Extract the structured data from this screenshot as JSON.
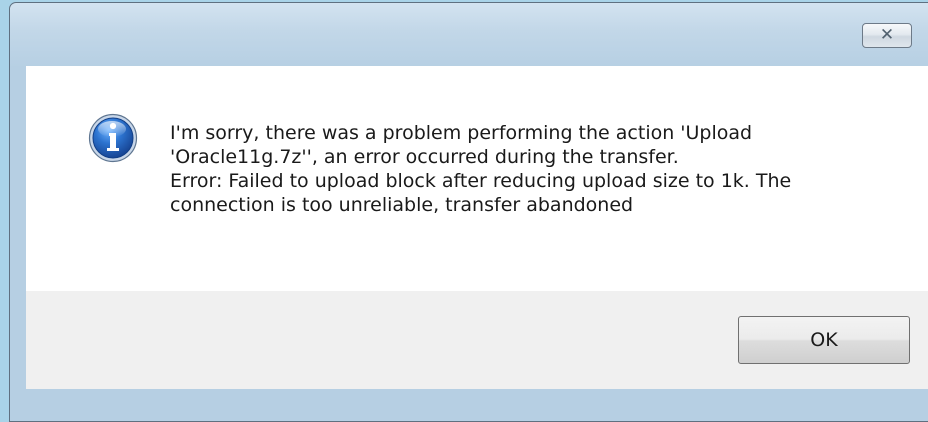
{
  "dialog": {
    "close_glyph": "✕",
    "icon": "info-icon",
    "message_lines": [
      "I'm sorry, there was a problem performing the action 'Upload",
      "'Oracle11g.7z'', an error occurred during the transfer.",
      "Error: Failed to upload block after reducing upload size to 1k. The",
      "connection is too unreliable, transfer abandoned"
    ],
    "ok_label": "OK"
  },
  "colors": {
    "desktop_background": "#a9d3e8",
    "frame": "#b6cfe3",
    "content_background": "#ffffff",
    "footer_background": "#f0f0f0",
    "info_icon_blue": "#1f5fb5"
  }
}
